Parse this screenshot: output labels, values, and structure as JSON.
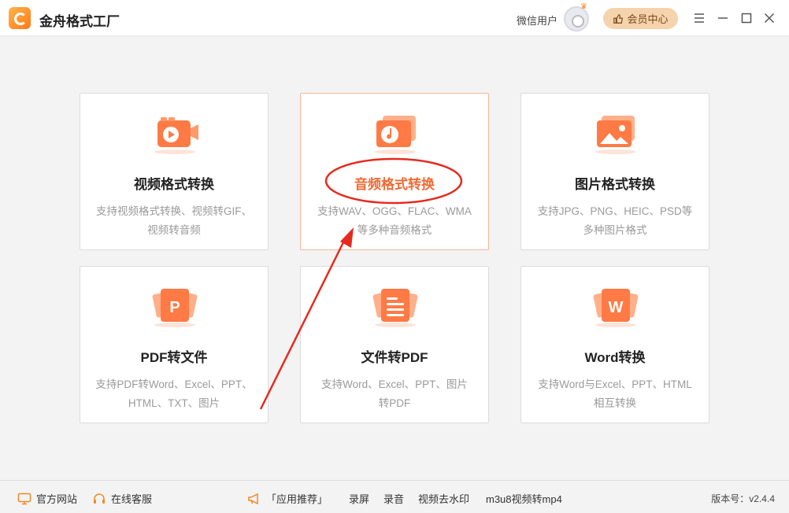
{
  "app": {
    "title": "金舟格式工厂"
  },
  "header": {
    "user_name": "微信用户",
    "vip_label": "会员中心"
  },
  "cards": [
    {
      "title": "视频格式转换",
      "desc_line1": "支持视频格式转换、视频转GIF、",
      "desc_line2": "视频转音频"
    },
    {
      "title": "音频格式转换",
      "desc_line1": "支持WAV、OGG、FLAC、WMA",
      "desc_line2": "等多种音频格式"
    },
    {
      "title": "图片格式转换",
      "desc_line1": "支持JPG、PNG、HEIC、PSD等",
      "desc_line2": "多种图片格式"
    },
    {
      "title": "PDF转文件",
      "desc_line1": "支持PDF转Word、Excel、PPT、",
      "desc_line2": "HTML、TXT、图片"
    },
    {
      "title": "文件转PDF",
      "desc_line1": "支持Word、Excel、PPT、图片",
      "desc_line2": "转PDF"
    },
    {
      "title": "Word转换",
      "desc_line1": "支持Word与Excel、PPT、HTML",
      "desc_line2": "相互转换"
    }
  ],
  "icons": {
    "letter_pdf": "P",
    "letter_word": "W"
  },
  "footer": {
    "official_site": "官方网站",
    "online_service": "在线客服",
    "recommend": "「应用推荐」",
    "links": [
      "录屏",
      "录音",
      "视频去水印",
      "m3u8视频转mp4"
    ],
    "version": "版本号：v2.4.4"
  },
  "colors": {
    "accent": "#f06a34",
    "annotation_red": "#e62a1e",
    "vip_bg": "#f5d3ad"
  }
}
